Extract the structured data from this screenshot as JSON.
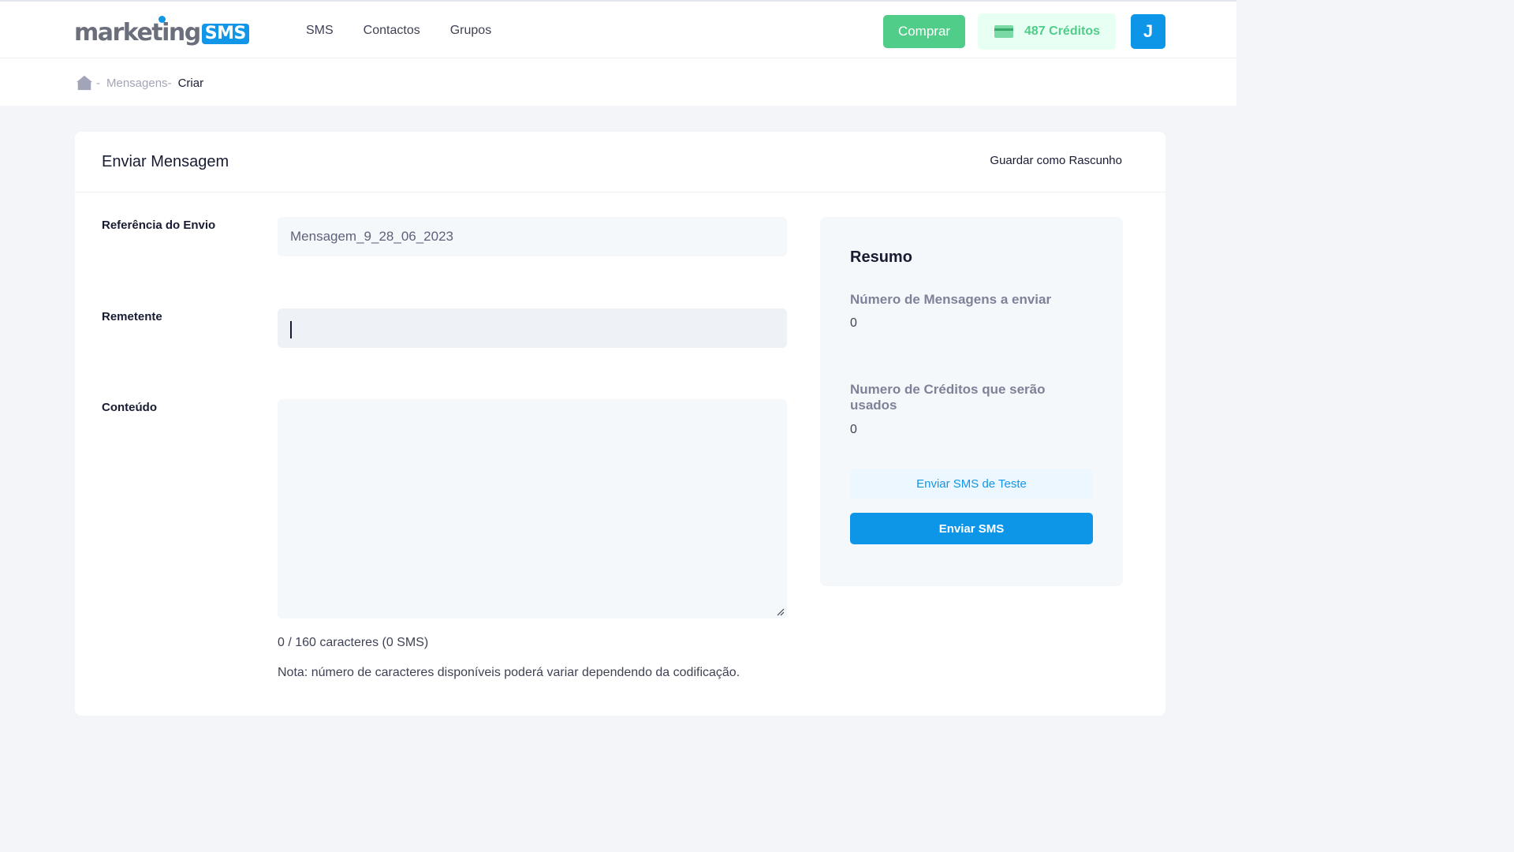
{
  "header": {
    "logo_text": "marketing",
    "logo_badge": "SMS",
    "nav": [
      {
        "label": "SMS"
      },
      {
        "label": "Contactos"
      },
      {
        "label": "Grupos"
      }
    ],
    "buy_label": "Comprar",
    "credits_label": "487 Créditos",
    "avatar_initial": "J",
    "colors": {
      "accent": "#0d95e8",
      "success": "#50cd89"
    }
  },
  "breadcrumb": {
    "home_icon": "home-icon",
    "sep1": "-",
    "parent": "Mensagens",
    "sep2": "-",
    "current": "Criar"
  },
  "form": {
    "title": "Enviar Mensagem",
    "draft_link": "Guardar como Rascunho",
    "reference_label": "Referência do Envio",
    "reference_value": "Mensagem_9_28_06_2023",
    "sender_label": "Remetente",
    "sender_value": "",
    "content_label": "Conteúdo",
    "content_value": "",
    "counter": "0 / 160 caracteres (0 SMS)",
    "note": "Nota: número de caracteres disponíveis poderá variar dependendo da codificação."
  },
  "summary": {
    "title": "Resumo",
    "messages_label": "Número de Mensagens a enviar",
    "messages_value": "0",
    "credits_label": "Numero de Créditos que serão usados",
    "credits_value": "0",
    "test_button": "Enviar SMS de Teste",
    "send_button": "Enviar SMS"
  }
}
